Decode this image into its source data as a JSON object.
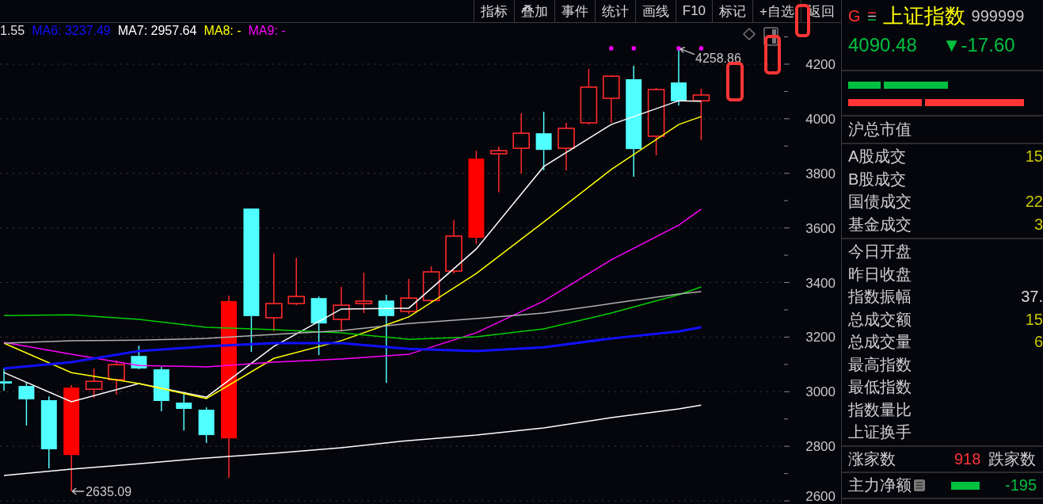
{
  "toolbar": [
    "指标",
    "叠加",
    "事件",
    "统计",
    "画线",
    "F10",
    "标记",
    "+自选",
    "返回"
  ],
  "chart_legend": [
    {
      "text": "1.55",
      "color": "#e0e0e0"
    },
    {
      "text": "MA6: 3237.49",
      "color": "#1010ff"
    },
    {
      "text": "MA7: 2957.64",
      "color": "#ffffff"
    },
    {
      "text": "MA8: -",
      "color": "#ffff00"
    },
    {
      "text": "MA9: -",
      "color": "#ff00ff"
    }
  ],
  "y_axis_labels": [
    "4200",
    "4000",
    "3800",
    "3600",
    "3400",
    "3200",
    "3000",
    "2800",
    "2600"
  ],
  "price_notes": [
    "4258.86",
    "2635.09"
  ],
  "quote": {
    "flag": "G",
    "name": "上证指数",
    "code": "999999",
    "price": "4090.48",
    "change": "▼-17.60"
  },
  "sections": [
    {
      "rows": [
        {
          "label": "沪总市值"
        }
      ]
    },
    {
      "rows": [
        {
          "label": "A股成交",
          "value": "15",
          "color": "#c8c800"
        },
        {
          "label": "B股成交"
        },
        {
          "label": "国债成交",
          "value": "22",
          "color": "#c8c800"
        },
        {
          "label": "基金成交",
          "value": "3",
          "color": "#c8c800"
        }
      ]
    },
    {
      "rows": [
        {
          "label": "今日开盘"
        },
        {
          "label": "昨日收盘"
        },
        {
          "label": "指数振幅",
          "value": "37.",
          "color": "#d8d8d8"
        },
        {
          "label": "总成交额",
          "value": "15",
          "color": "#c8c800"
        },
        {
          "label": "总成交量",
          "value": "6",
          "color": "#c8c800"
        },
        {
          "label": "最高指数"
        },
        {
          "label": "最低指数"
        },
        {
          "label": "指数量比"
        },
        {
          "label": "上证换手"
        }
      ]
    }
  ],
  "breadth": {
    "up_label": "涨家数",
    "up_value": "918",
    "down_label": "跌家数"
  },
  "net_flow": {
    "label": "主力净额",
    "value": "-195"
  }
}
